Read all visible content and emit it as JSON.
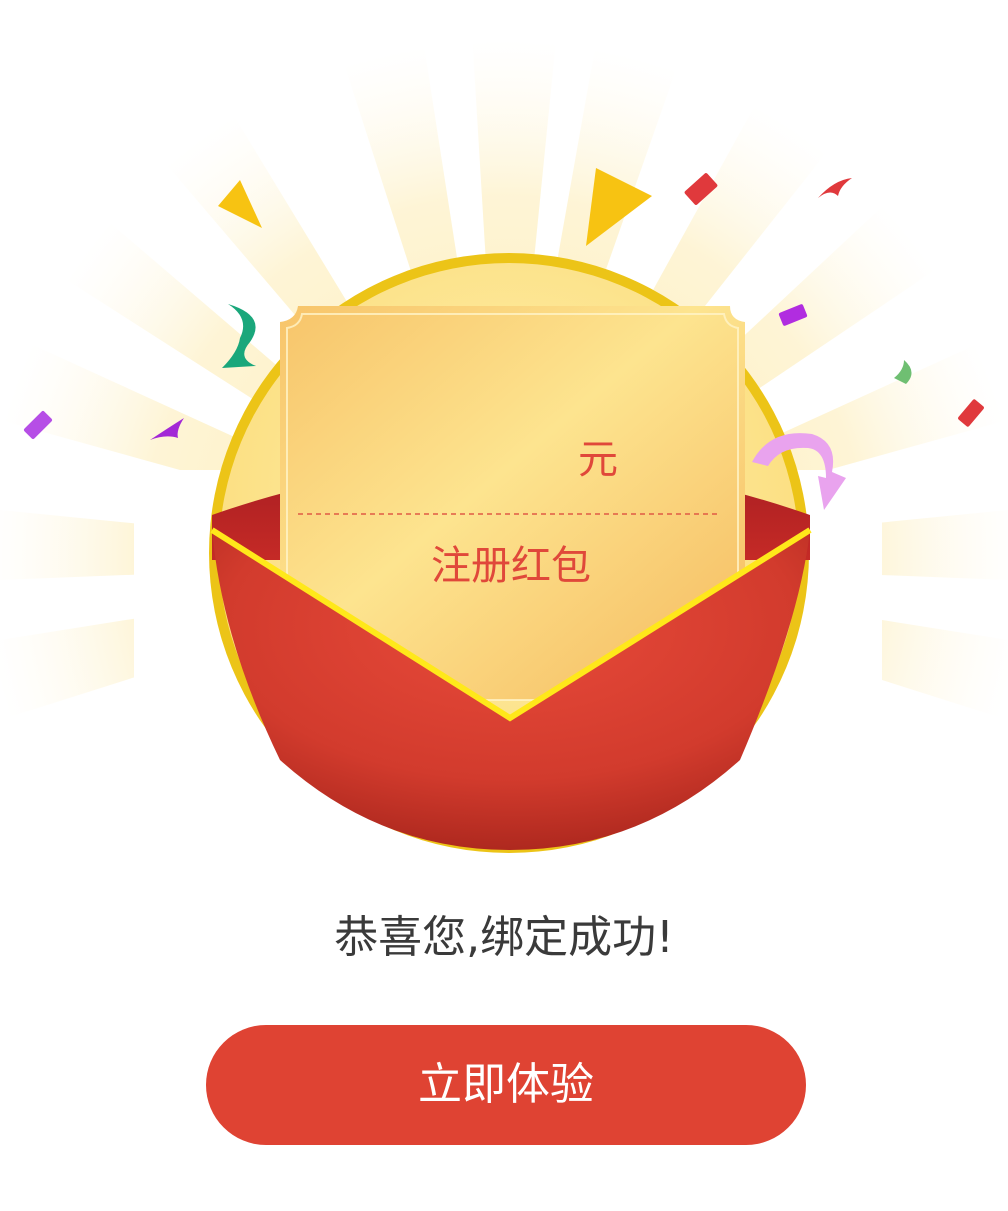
{
  "card": {
    "amount": "",
    "unit": "元",
    "label": "注册红包"
  },
  "message": "恭喜您,绑定成功!",
  "cta": {
    "label": "立即体验"
  },
  "colors": {
    "envelope_red": "#d8392c",
    "card_gold": "#fbe08e",
    "ring_gold": "#ecc417",
    "button_red": "#df4333",
    "text_red": "#e0483a",
    "text_dark": "#3a3a3a"
  }
}
